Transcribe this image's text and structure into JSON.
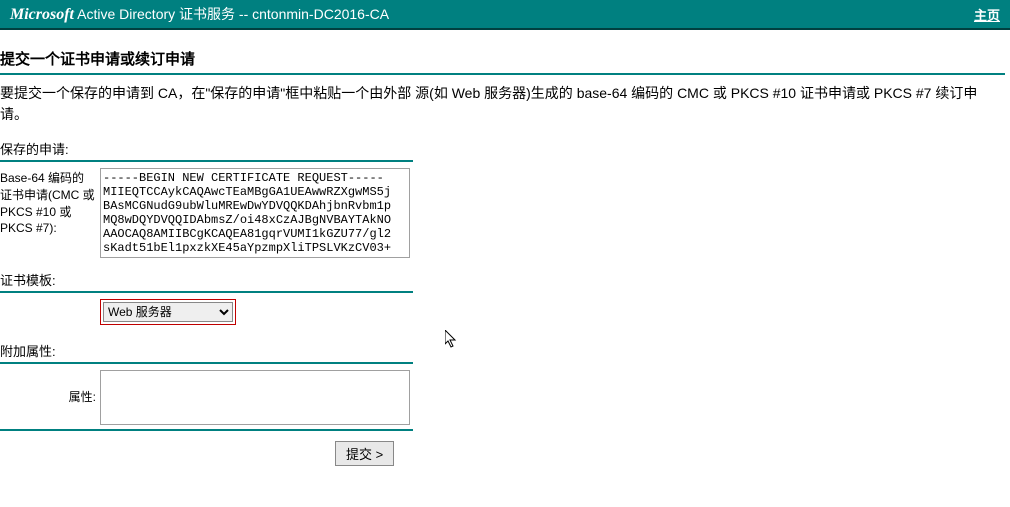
{
  "header": {
    "brand_italic": "Microsoft",
    "brand_rest": " Active Directory 证书服务  --  cntonmin-DC2016-CA",
    "home_link": "主页"
  },
  "page": {
    "title": "提交一个证书申请或续订申请",
    "instructions": "要提交一个保存的申请到 CA，在\"保存的申请\"框中粘贴一个由外部 源(如 Web 服务器)生成的 base-64 编码的 CMC 或 PKCS #10 证书申请或 PKCS #7 续订申请。"
  },
  "saved_request": {
    "section_label": "保存的申请:",
    "field_label": "Base-64 编码的证书申请(CMC 或 PKCS #10 或 PKCS #7):",
    "value": "-----BEGIN NEW CERTIFICATE REQUEST-----\nMIIEQTCCAykCAQAwcTEaMBgGA1UEAwwRZXgwMS5j\nBAsMCGNudG9ubWluMREwDwYDVQQKDAhjbnRvbm1p\nMQ8wDQYDVQQIDAbmsZ/oi48xCzAJBgNVBAYTAkNO\nAAOCAQ8AMIIBCgKCAQEA81gqrVUMI1kGZU77/gl2\nsKadt51bEl1pxzkXE45aYpzmpXliTPSLVKzCV03+"
  },
  "cert_template": {
    "section_label": "证书模板:",
    "selected": "Web 服务器",
    "options": [
      "Web 服务器"
    ]
  },
  "additional_attrs": {
    "section_label": "附加属性:",
    "field_label": "属性:",
    "value": ""
  },
  "submit": {
    "label": "提交 >"
  }
}
